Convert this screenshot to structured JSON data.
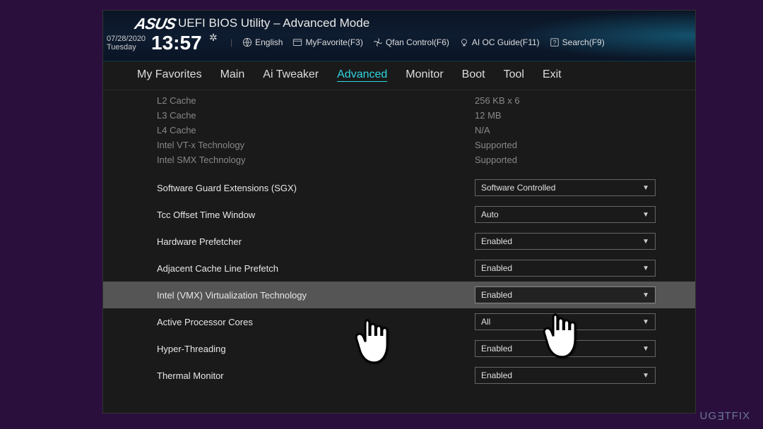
{
  "brand": "ASUS",
  "title": "UEFI BIOS Utility – Advanced Mode",
  "date": "07/28/2020",
  "day": "Tuesday",
  "time": "13:57",
  "topbar": {
    "language": "English",
    "myfavorite": "MyFavorite(F3)",
    "qfan": "Qfan Control(F6)",
    "aioc": "AI OC Guide(F11)",
    "search": "Search(F9)"
  },
  "tabs": [
    "My Favorites",
    "Main",
    "Ai Tweaker",
    "Advanced",
    "Monitor",
    "Boot",
    "Tool",
    "Exit"
  ],
  "activeTab": "Advanced",
  "info": [
    {
      "label": "L2 Cache",
      "value": "256 KB x 6"
    },
    {
      "label": "L3 Cache",
      "value": "12 MB"
    },
    {
      "label": "L4 Cache",
      "value": "N/A"
    },
    {
      "label": "Intel VT-x Technology",
      "value": "Supported"
    },
    {
      "label": "Intel SMX Technology",
      "value": "Supported"
    }
  ],
  "settings": [
    {
      "label": "Software Guard Extensions (SGX)",
      "value": "Software Controlled"
    },
    {
      "label": "Tcc Offset Time Window",
      "value": "Auto"
    },
    {
      "label": "Hardware Prefetcher",
      "value": "Enabled"
    },
    {
      "label": "Adjacent Cache Line Prefetch",
      "value": "Enabled"
    },
    {
      "label": "Intel (VMX) Virtualization Technology",
      "value": "Enabled",
      "highlight": true
    },
    {
      "label": "Active Processor Cores",
      "value": "All"
    },
    {
      "label": "Hyper-Threading",
      "value": "Enabled"
    },
    {
      "label": "Thermal Monitor",
      "value": "Enabled"
    }
  ],
  "watermark": "UGETFIX"
}
